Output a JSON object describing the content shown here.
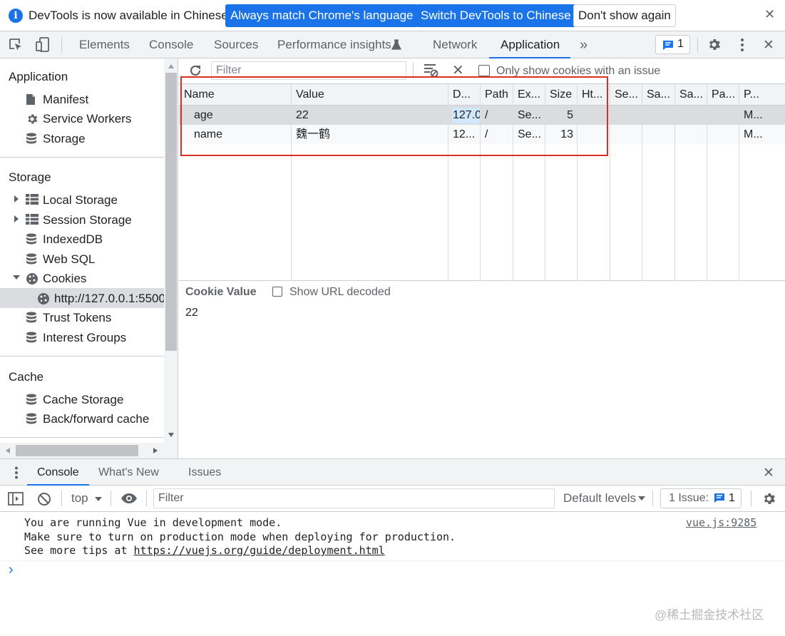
{
  "infobar": {
    "message": "DevTools is now available in Chinese!",
    "btn_match": "Always match Chrome's language",
    "btn_switch": "Switch DevTools to Chinese",
    "btn_dismiss": "Don't show again"
  },
  "tabs": {
    "elements": "Elements",
    "console": "Console",
    "sources": "Sources",
    "performance": "Performance insights",
    "network": "Network",
    "application": "Application",
    "more": "»",
    "issues_count": "1"
  },
  "sidebar": {
    "app_header": "Application",
    "app_items": [
      "Manifest",
      "Service Workers",
      "Storage"
    ],
    "storage_header": "Storage",
    "storage_items": [
      "Local Storage",
      "Session Storage",
      "IndexedDB",
      "Web SQL",
      "Cookies",
      "http://127.0.0.1:5500",
      "Trust Tokens",
      "Interest Groups"
    ],
    "cache_header": "Cache",
    "cache_items": [
      "Cache Storage",
      "Back/forward cache"
    ]
  },
  "cookie_toolbar": {
    "filter_placeholder": "Filter",
    "only_issues_label": "Only show cookies with an issue"
  },
  "cookie_table": {
    "headers": [
      "Name",
      "Value",
      "D...",
      "Path",
      "Ex...",
      "Size",
      "Ht...",
      "Se...",
      "Sa...",
      "Sa...",
      "Pa...",
      "P..."
    ],
    "rows": [
      {
        "name": "age",
        "value": "22",
        "domain": "127.0",
        "path": "/",
        "expires": "Se...",
        "size": "5",
        "priority": "M..."
      },
      {
        "name": "name",
        "value": "魏一鹤",
        "domain": "12...",
        "path": "/",
        "expires": "Se...",
        "size": "13",
        "priority": "M..."
      }
    ]
  },
  "cookie_value": {
    "title": "Cookie Value",
    "decode_label": "Show URL decoded",
    "value": "22"
  },
  "drawer": {
    "tab_console": "Console",
    "tab_whats_new": "What's New",
    "tab_issues": "Issues",
    "context": "top",
    "filter_placeholder": "Filter",
    "levels": "Default levels",
    "issues_label": "1 Issue:",
    "issues_count": "1"
  },
  "console_output": {
    "line1": "You are running Vue in development mode.",
    "line2": "Make sure to turn on production mode when deploying for production.",
    "line3_prefix": "See more tips at ",
    "line3_link": "https://vuejs.org/guide/deployment.html",
    "source": "vue.js:9285",
    "prompt": "›"
  },
  "watermark": "@稀土掘金技术社区",
  "colors": {
    "accent": "#1a73e8",
    "highlight_box": "#d93025",
    "selected_cell": "#cfe8fc"
  }
}
